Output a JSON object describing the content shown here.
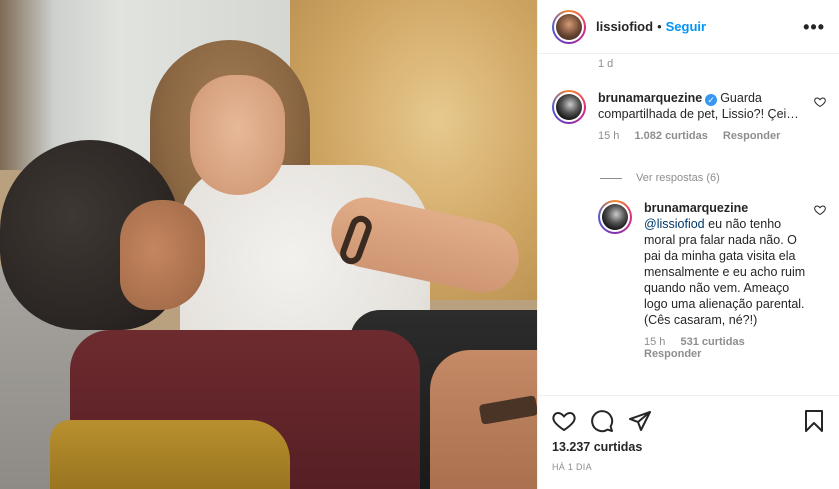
{
  "header": {
    "username": "lissiofiod",
    "separator": "•",
    "follow_label": "Seguir",
    "more_label": "•••"
  },
  "post": {
    "time_top": "1 d"
  },
  "comments": [
    {
      "username": "brunamarquezine",
      "verified_mark": "✓",
      "text": "Guarda compartilhada de pet, Lissio?! Çei…",
      "time": "15 h",
      "likes": "1.082 curtidas",
      "reply_label": "Responder",
      "view_replies": "Ver respostas (6)"
    }
  ],
  "reply": {
    "username": "brunamarquezine",
    "mention": "@lissiofiod",
    "text": "eu não tenho moral pra falar nada não. O pai da minha gata visita ela mensalmente e eu acho ruim quando não vem. Ameaço logo uma alienação parental. (Cês casaram, né?!)",
    "time": "15 h",
    "likes": "531 curtidas",
    "reply_label": "Responder"
  },
  "footer": {
    "likes_count": "13.237 curtidas",
    "posted_ago": "HÁ 1 DIA"
  },
  "colors": {
    "link_blue": "#0095f6",
    "verified_blue": "#3897f0",
    "muted_gray": "#8e8e8e",
    "text_dark": "#262626"
  },
  "icons": [
    "heart-icon",
    "comment-icon",
    "share-icon",
    "bookmark-icon",
    "more-icon",
    "verified-icon"
  ]
}
